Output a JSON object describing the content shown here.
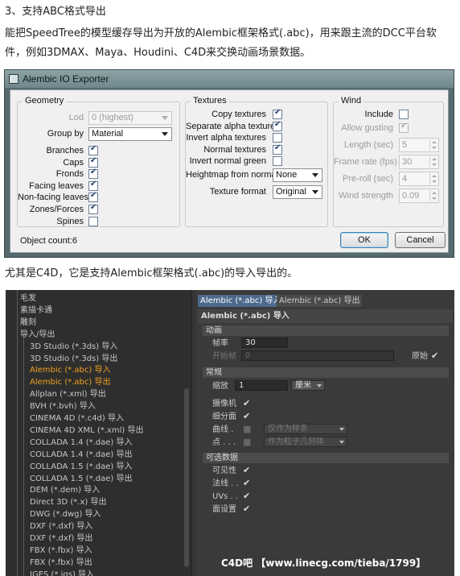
{
  "texts": {
    "heading": "3、支持ABC格式导出",
    "para1": "能把SpeedTree的模型缓存导出为开放的Alembic框架格式(.abc)，用来跟主流的DCC平台软",
    "para2": "件，例如3DMAX、Maya、Houdini、C4D来交换动画场景数据。",
    "para3": "尤其是C4D，它是支持Alembic框架格式(.abc)的导入导出的。"
  },
  "dialog": {
    "title": "Alembic IO Exporter",
    "geometry": {
      "title": "Geometry",
      "lod_label": "Lod",
      "lod_value": "0 (highest)",
      "group_by_label": "Group by",
      "group_by_value": "Material",
      "items": [
        {
          "label": "Branches",
          "checked": true
        },
        {
          "label": "Caps",
          "checked": true
        },
        {
          "label": "Fronds",
          "checked": true
        },
        {
          "label": "Facing leaves",
          "checked": true
        },
        {
          "label": "Non-facing leaves",
          "checked": true
        },
        {
          "label": "Zones/Forces",
          "checked": true
        },
        {
          "label": "Spines",
          "checked": false
        }
      ]
    },
    "textures": {
      "title": "Textures",
      "items": [
        {
          "label": "Copy textures",
          "checked": true
        },
        {
          "label": "Separate alpha textures",
          "checked": true
        },
        {
          "label": "Invert alpha textures",
          "checked": false
        },
        {
          "label": "Normal textures",
          "checked": true
        },
        {
          "label": "Invert normal green",
          "checked": false
        }
      ],
      "heightmap_label": "Heightmap from normal",
      "heightmap_value": "None",
      "texture_format_label": "Texture format",
      "texture_format_value": "Original"
    },
    "wind": {
      "title": "Wind",
      "include_label": "Include",
      "include_checked": false,
      "gusting_label": "Allow gusting",
      "gusting_checked": true,
      "length_label": "Length (sec)",
      "length_value": "5",
      "framerate_label": "Frame rate (fps)",
      "framerate_value": "30",
      "preroll_label": "Pre-roll (sec)",
      "preroll_value": "4",
      "strength_label": "Wind strength",
      "strength_value": "0.09"
    },
    "object_count": "Object count:6",
    "ok_label": "OK",
    "cancel_label": "Cancel"
  },
  "c4d": {
    "tree": [
      {
        "label": "毛发",
        "highlight": false
      },
      {
        "label": "素描卡通",
        "highlight": false
      },
      {
        "label": "雕刻",
        "highlight": false
      },
      {
        "label": "导入/导出",
        "highlight": false
      },
      {
        "label": "3D Studio (*.3ds) 导入",
        "highlight": false
      },
      {
        "label": "3D Studio (*.3ds) 导出",
        "highlight": false
      },
      {
        "label": "Alembic (*.abc) 导入",
        "highlight": true
      },
      {
        "label": "Alembic (*.abc) 导出",
        "highlight": true
      },
      {
        "label": "Allplan (*.xml) 导出",
        "highlight": false
      },
      {
        "label": "BVH (*.bvh) 导入",
        "highlight": false
      },
      {
        "label": "CINEMA 4D (*.c4d) 导入",
        "highlight": false
      },
      {
        "label": "CINEMA 4D XML (*.xml) 导出",
        "highlight": false
      },
      {
        "label": "COLLADA 1.4 (*.dae) 导入",
        "highlight": false
      },
      {
        "label": "COLLADA 1.4 (*.dae) 导出",
        "highlight": false
      },
      {
        "label": "COLLADA 1.5 (*.dae) 导入",
        "highlight": false
      },
      {
        "label": "COLLADA 1.5 (*.dae) 导出",
        "highlight": false
      },
      {
        "label": "DEM (*.dem) 导入",
        "highlight": false
      },
      {
        "label": "Direct 3D (*.x) 导出",
        "highlight": false
      },
      {
        "label": "DWG (*.dwg) 导入",
        "highlight": false
      },
      {
        "label": "DXF (*.dxf) 导入",
        "highlight": false
      },
      {
        "label": "DXF (*.dxf) 导出",
        "highlight": false
      },
      {
        "label": "FBX (*.fbx) 导入",
        "highlight": false
      },
      {
        "label": "FBX (*.fbx) 导出",
        "highlight": false
      },
      {
        "label": "IGES (*.igs) 导入",
        "highlight": false
      }
    ],
    "tab_import": "Alembic (*.abc) 导入",
    "tab_export": "Alembic (*.abc) 导出",
    "panel_title": "Alembic (*.abc) 导入",
    "anim_section": "动画",
    "frame_rate_label": "帧率",
    "frame_rate_value": "30",
    "start_frame_label": "开始帧",
    "start_frame_value": "0",
    "original_label": "原始",
    "general_section": "常规",
    "scale_label": "缩放",
    "scale_value": "1",
    "unit_value": "厘米",
    "camera_label": "摄像机",
    "subdiv_label": "细分面",
    "curve_label": "曲线 .",
    "curve_mode": "仅作为样条",
    "point_label": "点 . . .",
    "point_mode": "作为粒子几何体",
    "optional_section": "可选数据",
    "visibility_label": "可见性",
    "normals_label": "法线 . .",
    "uvs_label": "UVs . .",
    "face_label": "面设置",
    "watermark": "C4D吧 【www.linecg.com/tieba/1799】"
  }
}
